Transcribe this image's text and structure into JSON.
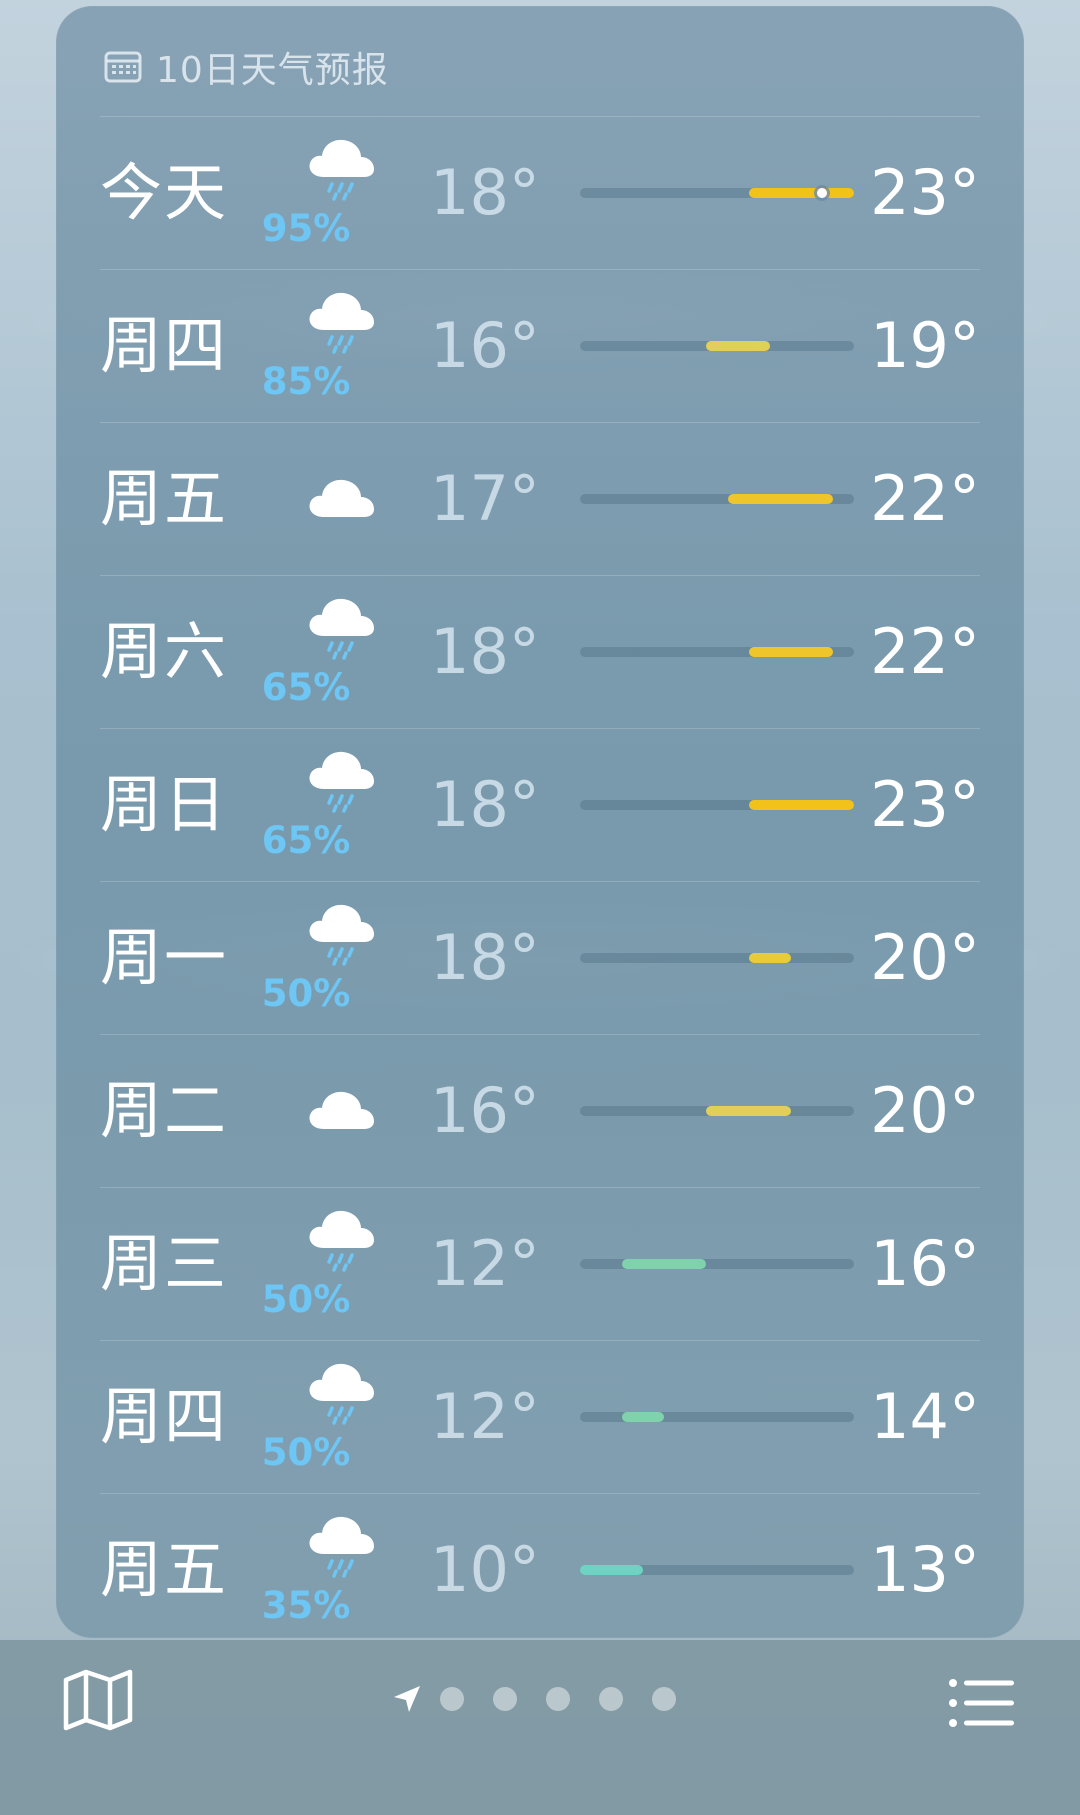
{
  "header": {
    "title": "10日天气预报",
    "icon": "calendar-icon"
  },
  "colors": {
    "warm_yellow": "#f2c21b",
    "pale_yellow": "#e1cf5a",
    "cool_green": "#7fd2ac",
    "cool_teal": "#6fd3c4",
    "precip_blue": "#6ec6f5"
  },
  "scale": {
    "min": 10,
    "max": 23
  },
  "forecast": [
    {
      "day": "今天",
      "icon": "cloud-rain-icon",
      "precip": "95%",
      "low": "18°",
      "high": "23°",
      "low_val": 18,
      "high_val": 23,
      "current_val": 21.5,
      "color": "#f2c21b"
    },
    {
      "day": "周四",
      "icon": "cloud-rain-icon",
      "precip": "85%",
      "low": "16°",
      "high": "19°",
      "low_val": 16,
      "high_val": 19,
      "color": "#e1cf5a"
    },
    {
      "day": "周五",
      "icon": "cloud-icon",
      "precip": "",
      "low": "17°",
      "high": "22°",
      "low_val": 17,
      "high_val": 22,
      "color": "#eec52a"
    },
    {
      "day": "周六",
      "icon": "cloud-rain-icon",
      "precip": "65%",
      "low": "18°",
      "high": "22°",
      "low_val": 18,
      "high_val": 22,
      "color": "#eec52a"
    },
    {
      "day": "周日",
      "icon": "cloud-rain-icon",
      "precip": "65%",
      "low": "18°",
      "high": "23°",
      "low_val": 18,
      "high_val": 23,
      "color": "#f2c21b"
    },
    {
      "day": "周一",
      "icon": "cloud-rain-icon",
      "precip": "50%",
      "low": "18°",
      "high": "20°",
      "low_val": 18,
      "high_val": 20,
      "color": "#e7cc3a"
    },
    {
      "day": "周二",
      "icon": "cloud-icon",
      "precip": "",
      "low": "16°",
      "high": "20°",
      "low_val": 16,
      "high_val": 20,
      "color": "#e1cf5a"
    },
    {
      "day": "周三",
      "icon": "cloud-rain-icon",
      "precip": "50%",
      "low": "12°",
      "high": "16°",
      "low_val": 12,
      "high_val": 16,
      "color": "#7fd2ac"
    },
    {
      "day": "周四",
      "icon": "cloud-rain-icon",
      "precip": "50%",
      "low": "12°",
      "high": "14°",
      "low_val": 12,
      "high_val": 14,
      "color": "#7fd2ac"
    },
    {
      "day": "周五",
      "icon": "cloud-rain-icon",
      "precip": "35%",
      "low": "10°",
      "high": "13°",
      "low_val": 10,
      "high_val": 13,
      "color": "#6fd3c4"
    }
  ],
  "toolbar": {
    "map_icon": "map-icon",
    "location_icon": "location-arrow-icon",
    "page_count": 5,
    "list_icon": "list-icon"
  }
}
